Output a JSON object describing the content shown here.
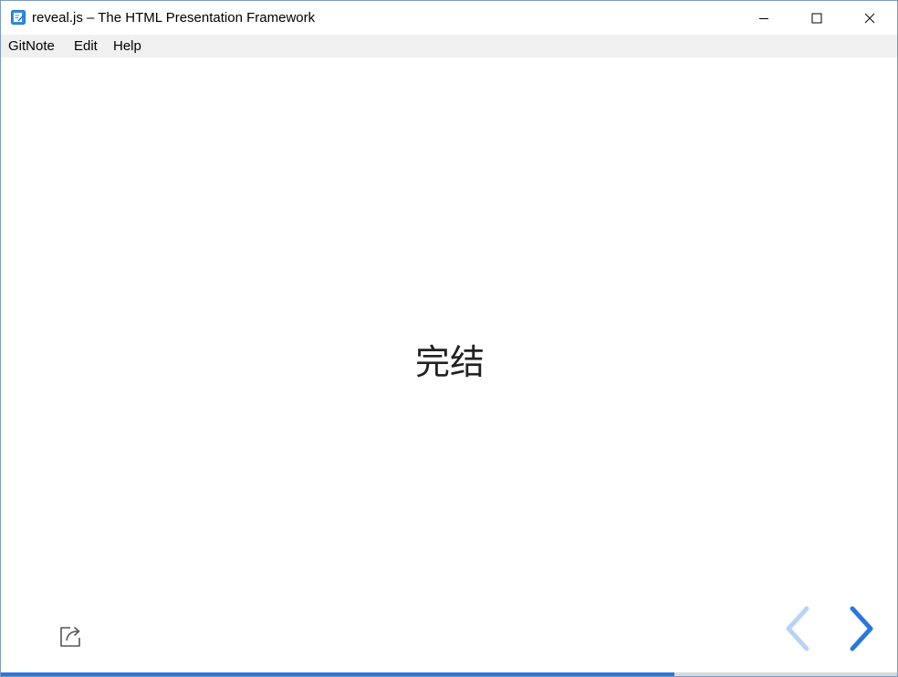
{
  "window": {
    "title": "reveal.js – The HTML Presentation Framework"
  },
  "menu": {
    "items": [
      "GitNote",
      "Edit",
      "Help"
    ]
  },
  "slide": {
    "heading": "完结"
  },
  "controls": {
    "share_icon": "share-export-icon",
    "prev_icon": "chevron-left-icon",
    "next_icon": "chevron-right-icon",
    "prev_enabled": false,
    "next_enabled": true
  },
  "progress": {
    "fraction": 0.75
  },
  "colors": {
    "accent": "#2a76dd",
    "accent_disabled": "#b9d3f3",
    "menubar_bg": "#f0f0f0"
  }
}
